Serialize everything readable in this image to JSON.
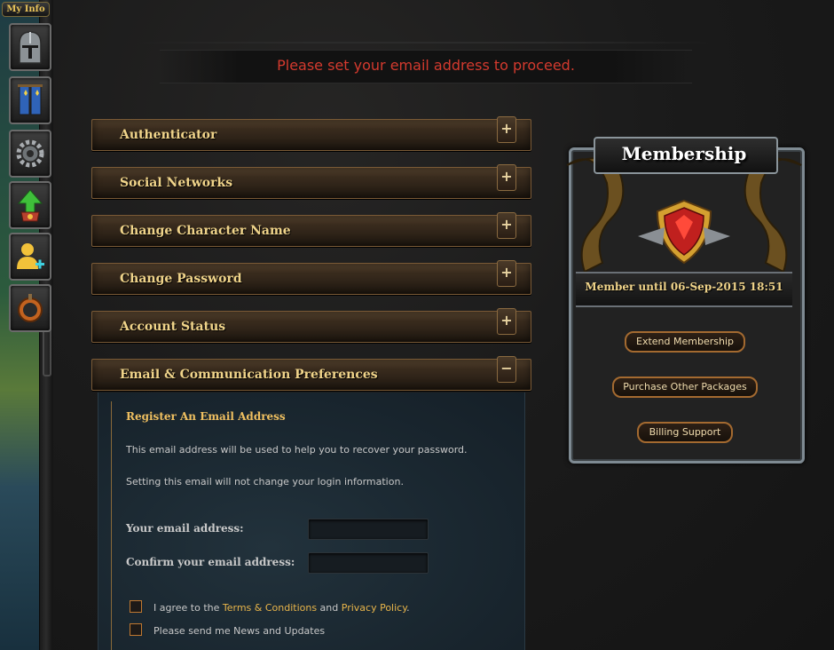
{
  "left_nav": {
    "my_info_label": "My Info",
    "buttons": [
      {
        "name": "helmet-icon"
      },
      {
        "name": "banner-icon"
      },
      {
        "name": "gear-icon"
      },
      {
        "name": "upgrade-icon"
      },
      {
        "name": "add-friend-icon"
      },
      {
        "name": "bomb-icon"
      }
    ]
  },
  "banner": {
    "message": "Please set your email address to proceed."
  },
  "accordion": {
    "items": [
      {
        "label": "Authenticator",
        "toggle": "+"
      },
      {
        "label": "Social Networks",
        "toggle": "+"
      },
      {
        "label": "Change Character Name",
        "toggle": "+"
      },
      {
        "label": "Change Password",
        "toggle": "+"
      },
      {
        "label": "Account Status",
        "toggle": "+"
      },
      {
        "label": "Email & Communication Preferences",
        "toggle": "−"
      }
    ]
  },
  "email_panel": {
    "title": "Register An Email Address",
    "desc1": "This email address will be used to help you to recover your password.",
    "desc2": "Setting this email will not change your login information.",
    "email_label": "Your email address:",
    "email_value": "",
    "confirm_label": "Confirm your email address:",
    "confirm_value": "",
    "agree_prefix": "I agree to the ",
    "terms_link": "Terms & Conditions",
    "agree_and": " and ",
    "privacy_link": "Privacy Policy",
    "agree_suffix": ".",
    "news_label": "Please send me News and Updates"
  },
  "membership": {
    "title": "Membership",
    "until": "Member until 06-Sep-2015 18:51",
    "extend_label": "Extend Membership",
    "purchase_label": "Purchase Other Packages",
    "billing_label": "Billing Support"
  },
  "colors": {
    "accent_gold": "#f0d48a",
    "banner_red": "#d43a2e",
    "link_gold": "#e8b54a",
    "button_border": "#a46a30"
  }
}
